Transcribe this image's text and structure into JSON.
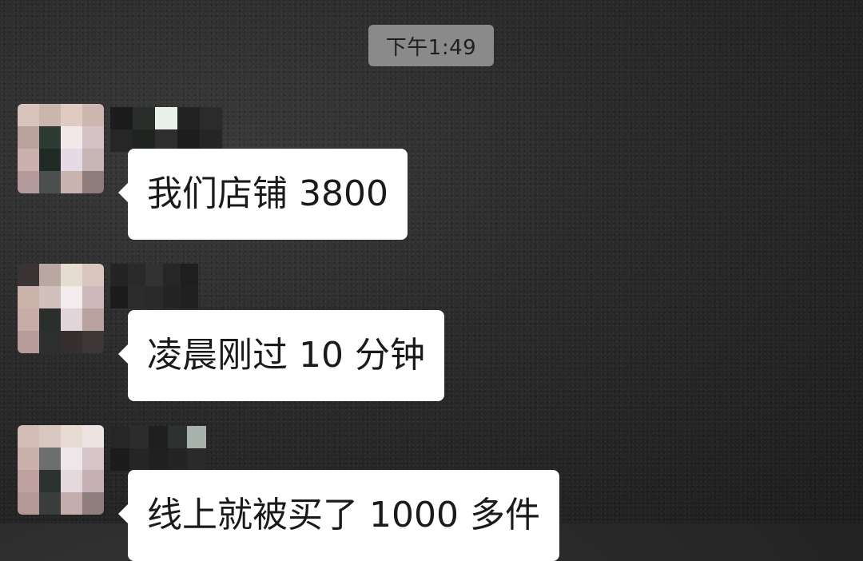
{
  "timestamp": "下午1:49",
  "colors": {
    "bubble": "#ffffff",
    "timestamp_bg": "#8a8a8a",
    "background": "#2a2a2a"
  },
  "messages": [
    {
      "text": "我们店铺 3800"
    },
    {
      "text": "凌晨刚过 10 分钟"
    },
    {
      "text": "线上就被买了 1000 多件"
    }
  ]
}
